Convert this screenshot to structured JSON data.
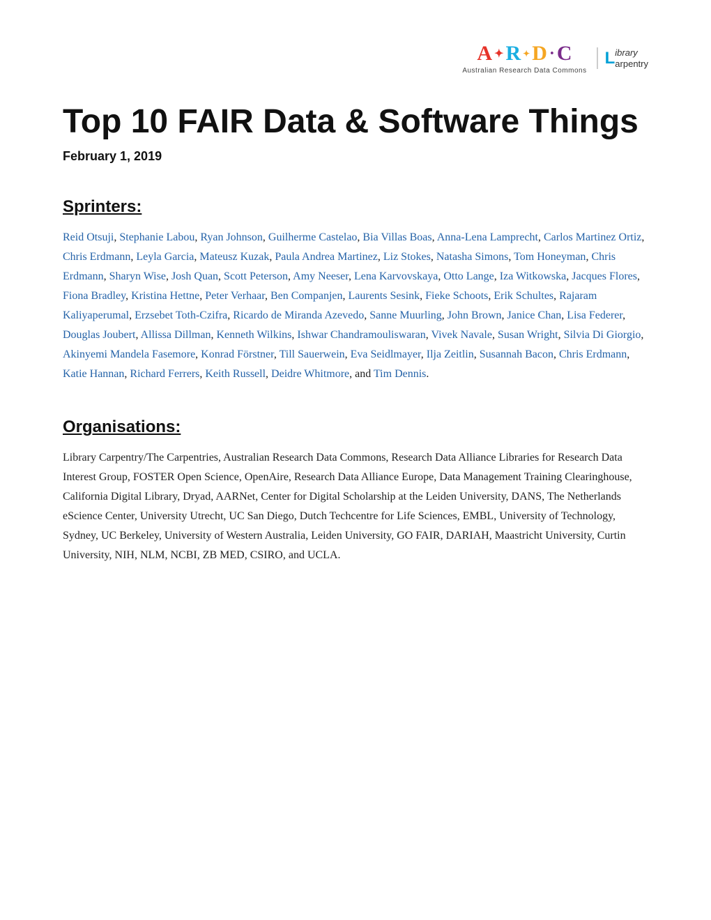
{
  "header": {
    "ardc_label": "Australian Research Data Commons",
    "lc_line1": "ibrary",
    "lc_line2": "arpentry"
  },
  "title": "Top 10 FAIR Data & Software Things",
  "date": "February 1, 2019",
  "sections": {
    "sprinters": {
      "heading": "Sprinters:",
      "links": [
        "Reid Otsuji",
        "Stephanie Labou",
        "Ryan Johnson",
        "Guilherme Castelao",
        "Bia Villas Boas",
        "Anna-Lena Lamprecht",
        "Carlos Martinez Ortiz",
        "Chris Erdmann",
        "Leyla Garcia",
        "Mateusz Kuzak",
        "Paula Andrea Martinez",
        "Liz Stokes",
        "Natasha Simons",
        "Tom Honeyman",
        "Chris Erdmann",
        "Sharyn Wise",
        "Josh Quan",
        "Scott Peterson",
        "Amy Neeser",
        "Lena Karvovskaya",
        "Otto Lange",
        "Iza Witkowska",
        "Jacques Flores",
        "Fiona Bradley",
        "Kristina Hettne",
        "Peter Verhaar",
        "Ben Companjen",
        "Laurents Sesink",
        "Fieke Schoots",
        "Erik Schultes",
        "Rajaram Kaliyaperumal",
        "Erzsebet Toth-Czifra",
        "Ricardo de Miranda Azevedo",
        "Sanne Muurling",
        "John Brown",
        "Janice Chan",
        "Lisa Federer",
        "Douglas Joubert",
        "Allissa Dillman",
        "Kenneth Wilkins",
        "Ishwar Chandramouliswaran",
        "Vivek Navale",
        "Susan Wright",
        "Silvia Di Giorgio",
        "Akinyemi Mandela Fasemore",
        "Konrad Förstner",
        "Till Sauerwein",
        "Eva Seidlmayer",
        "Ilja Zeitlin",
        "Susannah Bacon",
        "Chris Erdmann",
        "Katie Hannan",
        "Richard Ferrers",
        "Keith Russell",
        "Deidre Whitmore",
        "Tim Dennis"
      ]
    },
    "organisations": {
      "heading": "Organisations:",
      "text": "Library Carpentry/The Carpentries, Australian Research Data Commons, Research Data Alliance Libraries for Research Data Interest Group, FOSTER Open Science, OpenAire, Research Data Alliance Europe, Data Management Training Clearinghouse, California Digital Library, Dryad, AARNet, Center for Digital Scholarship at the Leiden University, DANS, The Netherlands eScience Center, University Utrecht, UC San Diego, Dutch Techcentre for Life Sciences, EMBL, University of Technology, Sydney, UC Berkeley, University of Western Australia, Leiden University, GO FAIR, DARIAH, Maastricht University, Curtin University, NIH, NLM, NCBI, ZB MED, CSIRO, and UCLA."
    }
  }
}
